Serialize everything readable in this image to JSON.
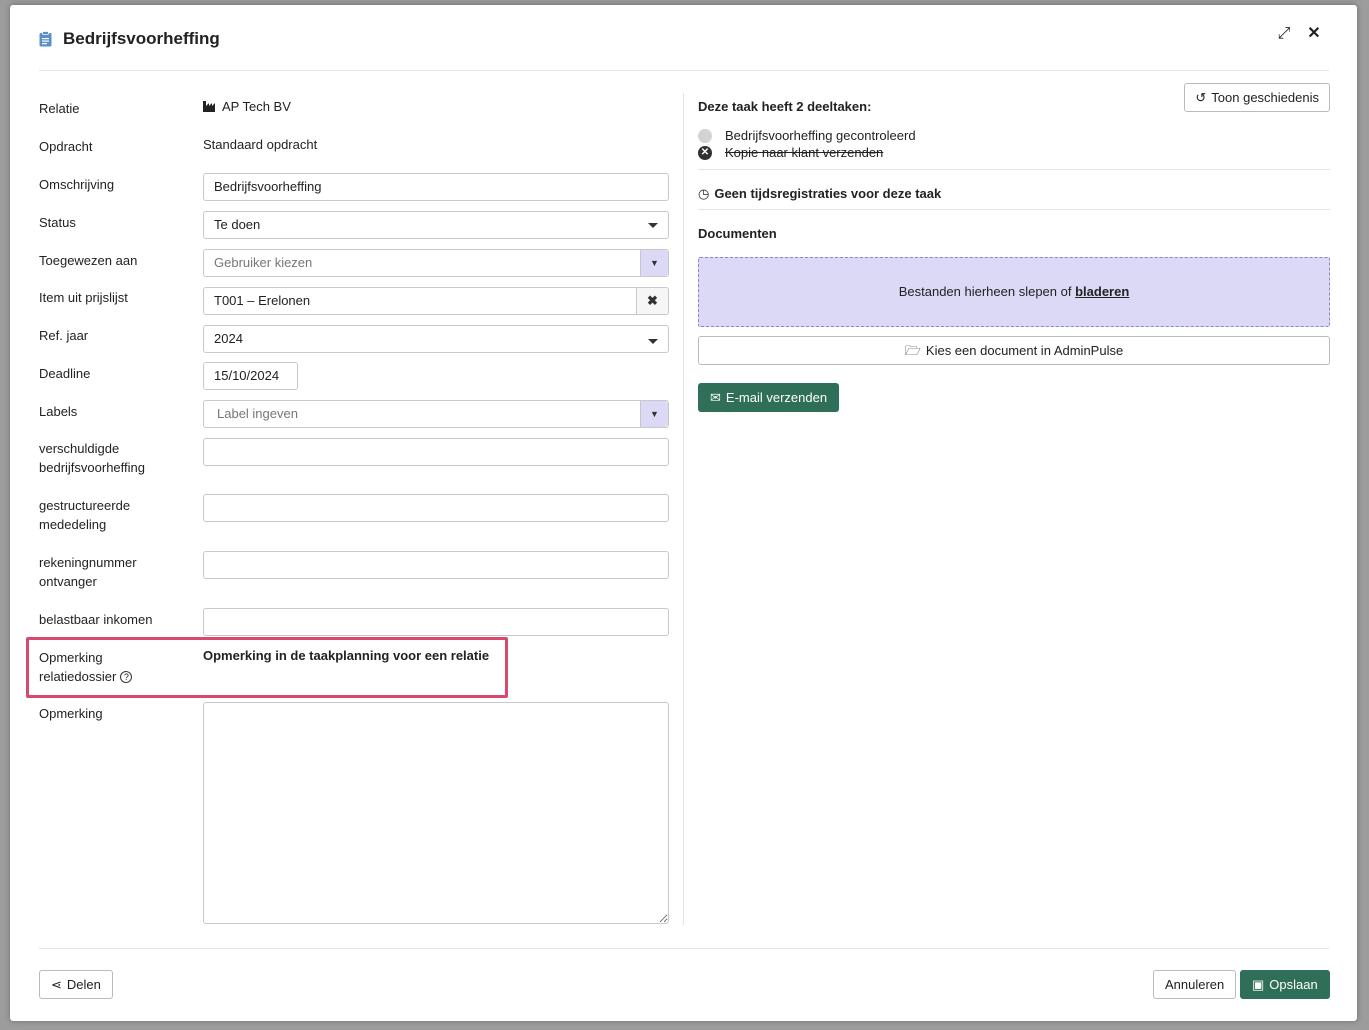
{
  "modal": {
    "title": "Bedrijfsvoorheffing"
  },
  "form": {
    "relatie": {
      "label": "Relatie",
      "value": "AP Tech BV"
    },
    "opdracht": {
      "label": "Opdracht",
      "value": "Standaard opdracht"
    },
    "omschrijving": {
      "label": "Omschrijving",
      "value": "Bedrijfsvoorheffing"
    },
    "status": {
      "label": "Status",
      "value": "Te doen"
    },
    "toegewezen": {
      "label": "Toegewezen aan",
      "placeholder": "Gebruiker kiezen"
    },
    "item": {
      "label": "Item uit prijslijst",
      "value": "T001 – Erelonen"
    },
    "refjaar": {
      "label": "Ref. jaar",
      "value": "2024"
    },
    "deadline": {
      "label": "Deadline",
      "value": "15/10/2024"
    },
    "labels": {
      "label": "Labels",
      "placeholder": "Label ingeven"
    },
    "verschuldigde": {
      "label_line1": "verschuldigde",
      "label_line2": "bedrijfsvoorheffing",
      "value": ""
    },
    "gestructureerde": {
      "label_line1": "gestructureerde",
      "label_line2": "mededeling",
      "value": ""
    },
    "rekeningnummer": {
      "label_line1": "rekeningnummer",
      "label_line2": "ontvanger",
      "value": ""
    },
    "belastbaar": {
      "label": "belastbaar inkomen",
      "value": ""
    },
    "opmerking_relatiedossier": {
      "label_line1": "Opmerking",
      "label_line2": "relatiedossier",
      "value": "Opmerking in de taakplanning voor een relatie"
    },
    "opmerking": {
      "label": "Opmerking",
      "value": ""
    }
  },
  "subtasks": {
    "title": "Deze taak heeft 2 deeltaken:",
    "items": [
      {
        "label": "Bedrijfsvoorheffing gecontroleerd",
        "state": "open"
      },
      {
        "label": "Kopie naar klant verzenden",
        "state": "cancelled"
      }
    ]
  },
  "history_button": "Toon geschiedenis",
  "time_registrations": "Geen tijdsregistraties voor deze taak",
  "documents": {
    "title": "Documenten",
    "drop_text": "Bestanden hierheen slepen of",
    "drop_link": "bladeren",
    "pick_button": "Kies een document in AdminPulse"
  },
  "email_button": "E-mail verzenden",
  "footer": {
    "share": "Delen",
    "cancel": "Annuleren",
    "save": "Opslaan"
  },
  "colors": {
    "primary": "#2f6e57",
    "accent_light": "#dcd9f7",
    "highlight": "#d9496e"
  }
}
